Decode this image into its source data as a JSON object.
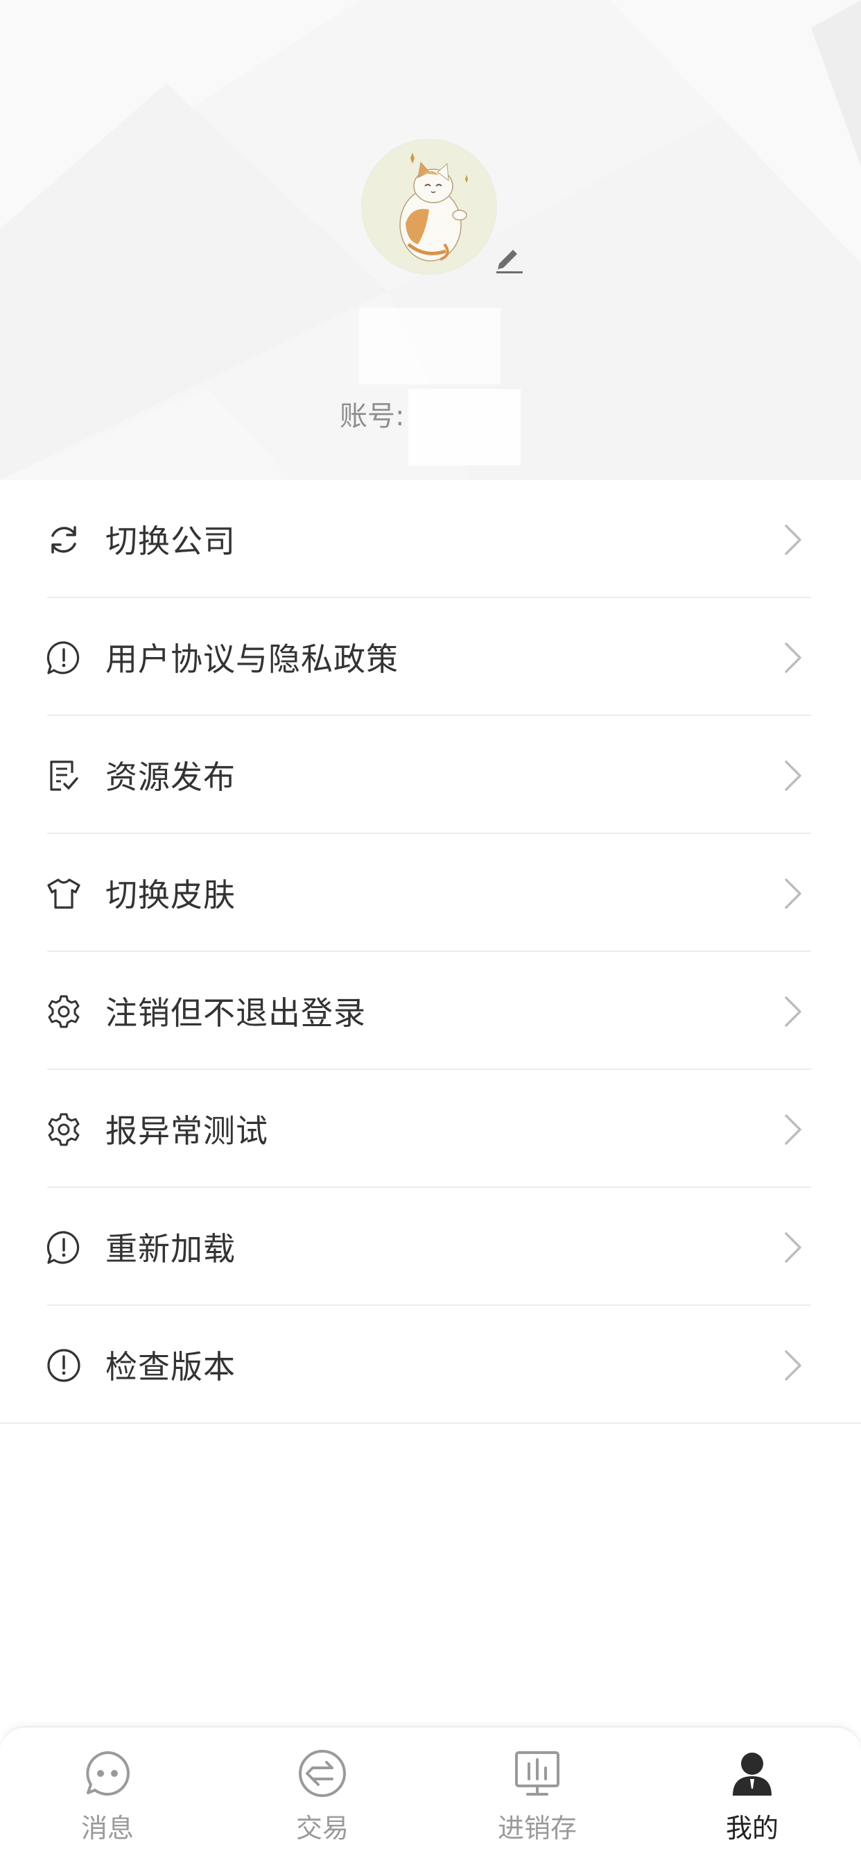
{
  "profile": {
    "account_label": "账号:",
    "account_value": "",
    "username": ""
  },
  "menu": {
    "items": [
      {
        "label": "切换公司",
        "icon": "refresh-icon"
      },
      {
        "label": "用户协议与隐私政策",
        "icon": "speech-alert-icon"
      },
      {
        "label": "资源发布",
        "icon": "document-check-icon"
      },
      {
        "label": "切换皮肤",
        "icon": "tshirt-icon"
      },
      {
        "label": "注销但不退出登录",
        "icon": "gear-icon"
      },
      {
        "label": "报异常测试",
        "icon": "gear-icon"
      },
      {
        "label": "重新加载",
        "icon": "speech-alert-icon"
      },
      {
        "label": "检查版本",
        "icon": "alert-circle-icon"
      }
    ]
  },
  "tabbar": {
    "tabs": [
      {
        "label": "消息",
        "icon": "chat-bubble-icon"
      },
      {
        "label": "交易",
        "icon": "exchange-icon"
      },
      {
        "label": "进销存",
        "icon": "chart-board-icon"
      },
      {
        "label": "我的",
        "icon": "person-icon"
      }
    ],
    "active_index": 3
  },
  "colors": {
    "text_primary": "#333333",
    "text_secondary": "#9a9a9a",
    "divider": "#ececec",
    "header_bg": "#f6f6f6",
    "active_tab": "#222222"
  }
}
